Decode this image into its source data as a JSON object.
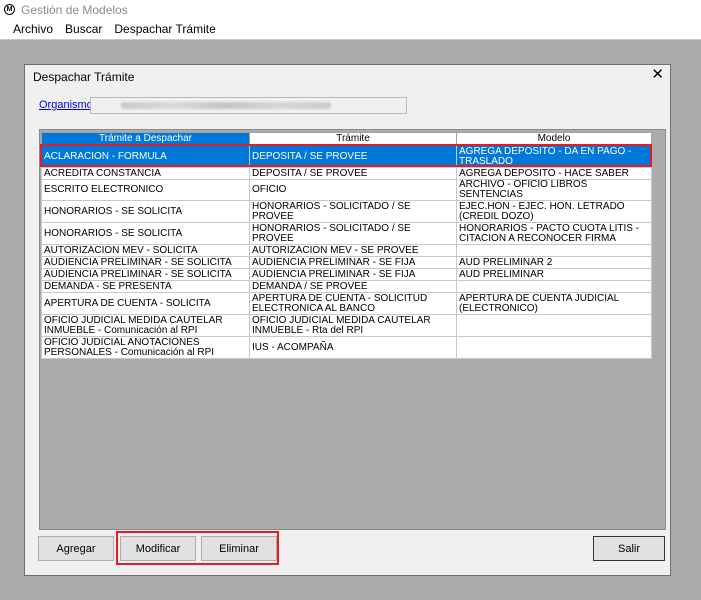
{
  "window": {
    "title": "Gestión de Modelos",
    "icon_glyph": "M"
  },
  "menu": [
    "Archivo",
    "Buscar",
    "Despachar Trámite"
  ],
  "dialog": {
    "title": "Despachar Trámite",
    "close_glyph": "✕",
    "organismo_label": "Organismo",
    "columns": [
      "Trámite a Despachar",
      "Trámite",
      "Modelo"
    ],
    "rows": [
      [
        "ACLARACION - FORMULA",
        "DEPOSITA / SE PROVEE",
        "AGREGA DEPOSITO - DA EN PAGO - TRASLADO"
      ],
      [
        "ACREDITA CONSTANCIA",
        "DEPOSITA / SE PROVEE",
        "AGREGA DEPOSITO - HACE SABER"
      ],
      [
        "ESCRITO  ELECTRONICO",
        "OFICIO",
        "ARCHIVO - OFICIO LIBROS SENTENCIAS"
      ],
      [
        "HONORARIOS - SE SOLICITA",
        "HONORARIOS - SOLICITADO / SE PROVEE",
        "EJEC.HON - EJEC. HON. LETRADO (CREDIL DOZO)"
      ],
      [
        "HONORARIOS - SE SOLICITA",
        "HONORARIOS - SOLICITADO / SE PROVEE",
        "HONORARIOS - PACTO CUOTA LITIS - CITACION A RECONOCER FIRMA"
      ],
      [
        "AUTORIZACION MEV - SOLICITA",
        "AUTORIZACION MEV - SE PROVEE",
        ""
      ],
      [
        "AUDIENCIA PRELIMINAR - SE SOLICITA",
        "AUDIENCIA PRELIMINAR - SE FIJA",
        "AUD PRELIMINAR 2"
      ],
      [
        "AUDIENCIA PRELIMINAR - SE SOLICITA",
        "AUDIENCIA PRELIMINAR - SE FIJA",
        "AUD PRELIMINAR"
      ],
      [
        "DEMANDA - SE PRESENTA",
        "DEMANDA / SE PROVEE",
        ""
      ],
      [
        "APERTURA DE CUENTA - SOLICITA",
        "APERTURA DE CUENTA - SOLICITUD ELECTRONICA AL BANCO",
        "APERTURA DE CUENTA JUDICIAL (ELECTRONICO)"
      ],
      [
        "OFICIO JUDICIAL MEDIDA CAUTELAR INMUEBLE - Comunicación al RPI",
        "OFICIO JUDICIAL MEDIDA CAUTELAR INMUEBLE - Rta del RPI",
        ""
      ],
      [
        "OFICIO JUDICIAL ANOTACIONES PERSONALES - Comunicación al RPI",
        "IUS - ACOMPAÑA",
        ""
      ]
    ],
    "buttons": {
      "agregar": "Agregar",
      "modificar": "Modificar",
      "eliminar": "Eliminar",
      "salir": "Salir"
    }
  },
  "colors": {
    "selection": "#0078d7",
    "highlight_outline": "#e21d28",
    "workspace": "#ababab"
  }
}
